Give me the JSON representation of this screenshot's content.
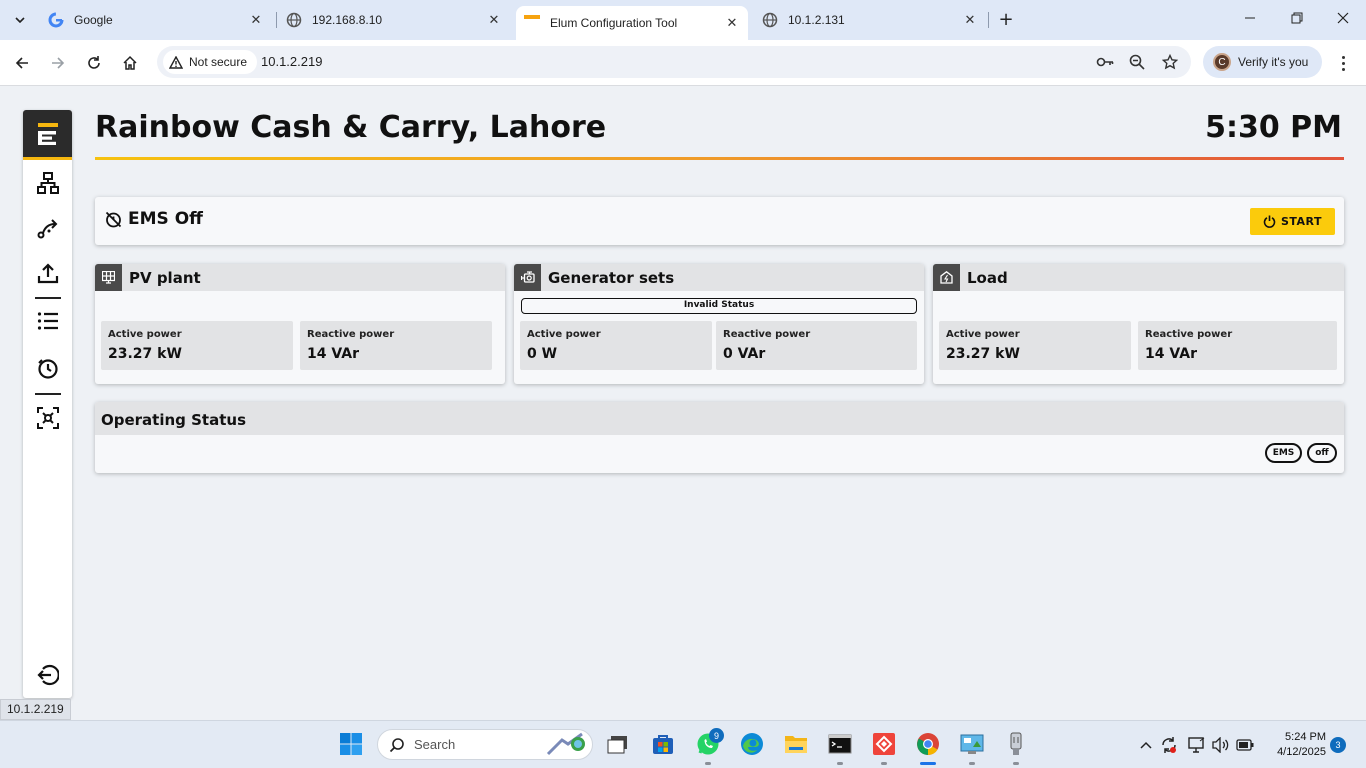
{
  "browser": {
    "tabs": [
      {
        "title": "Google",
        "active": false
      },
      {
        "title": "192.168.8.10",
        "active": false
      },
      {
        "title": "Elum Configuration Tool",
        "active": true
      },
      {
        "title": "10.1.2.131",
        "active": false
      }
    ],
    "security_label": "Not secure",
    "url": "10.1.2.219",
    "verify_label": "Verify it's you",
    "avatar_letter": "C",
    "status_url": "10.1.2.219"
  },
  "header": {
    "site_name": "Rainbow Cash & Carry, Lahore",
    "time": "5:30 PM"
  },
  "ems": {
    "status_label": "EMS Off",
    "start_label": "START"
  },
  "panels": {
    "pv": {
      "title": "PV plant",
      "active_label": "Active power",
      "active_value": "23.27 kW",
      "reactive_label": "Reactive power",
      "reactive_value": "14 VAr"
    },
    "gen": {
      "title": "Generator sets",
      "status": "Invalid Status",
      "active_label": "Active power",
      "active_value": "0 W",
      "reactive_label": "Reactive power",
      "reactive_value": "0 VAr"
    },
    "load": {
      "title": "Load",
      "active_label": "Active power",
      "active_value": "23.27 kW",
      "reactive_label": "Reactive power",
      "reactive_value": "14 VAr"
    }
  },
  "operating_status": {
    "title": "Operating Status",
    "chips": [
      "EMS",
      "off"
    ]
  },
  "taskbar": {
    "search_placeholder": "Search",
    "whatsapp_badge": "9",
    "time": "5:24 PM",
    "date": "4/12/2025",
    "notification_count": "3"
  },
  "colors": {
    "accent": "#fbcb0c",
    "brand_dark": "#2b2b2b",
    "gradient": [
      "#f6c20f",
      "#e2533a"
    ]
  }
}
